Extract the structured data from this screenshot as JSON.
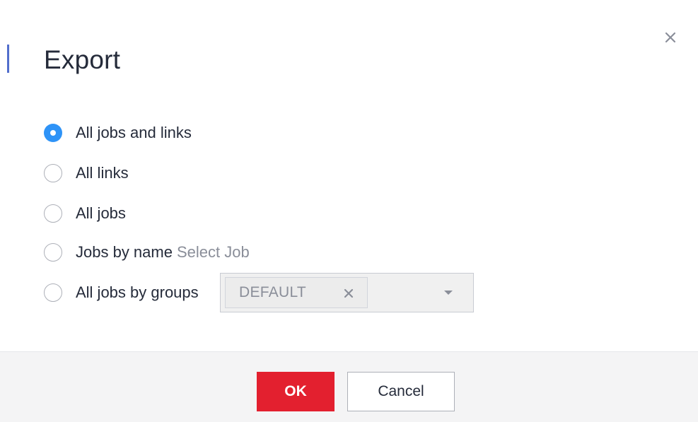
{
  "dialog": {
    "title": "Export",
    "close_icon": "close-icon"
  },
  "options": [
    {
      "label": "All jobs and links",
      "checked": true
    },
    {
      "label": "All links",
      "checked": false
    },
    {
      "label": "All jobs",
      "checked": false
    },
    {
      "label": "Jobs by name",
      "checked": false,
      "inline_link": "Select Job"
    },
    {
      "label": "All jobs by groups",
      "checked": false
    }
  ],
  "group_select": {
    "selected_tags": [
      "DEFAULT"
    ],
    "tag_remove_icon": "close-icon",
    "caret_icon": "caret-down-icon"
  },
  "footer": {
    "ok_label": "OK",
    "cancel_label": "Cancel"
  },
  "colors": {
    "accent": "#526ecc",
    "radio_checked": "#2e93f7",
    "ok_button": "#e3202f",
    "footer_bg": "#f4f4f5"
  }
}
